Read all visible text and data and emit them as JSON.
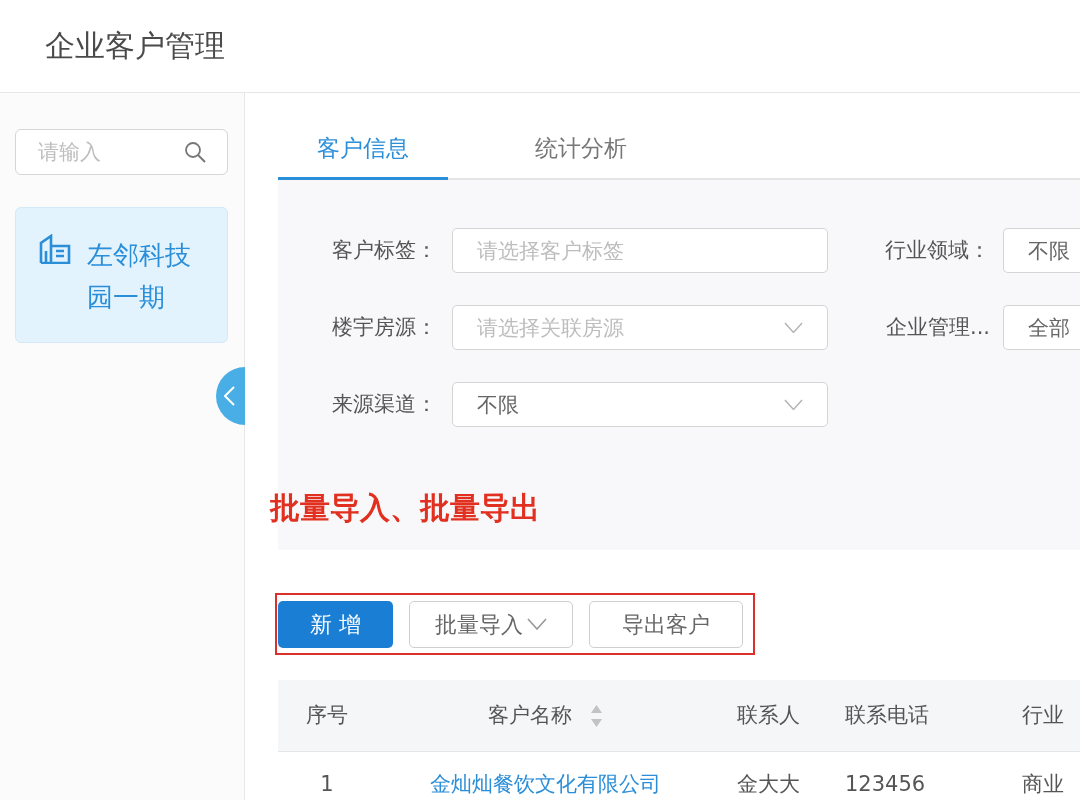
{
  "header": {
    "title": "企业客户管理"
  },
  "sidebar": {
    "search": {
      "placeholder": "请输入"
    },
    "items": [
      {
        "label": "左邻科技园一期",
        "selected": true
      }
    ]
  },
  "tabs": [
    {
      "label": "客户信息",
      "selected": true
    },
    {
      "label": "统计分析",
      "selected": false
    }
  ],
  "filters": [
    {
      "label": "客户标签：",
      "kind": "input",
      "placeholder": "请选择客户标签"
    },
    {
      "label": "行业领域：",
      "kind": "input",
      "value": "不限"
    },
    {
      "label": "楼宇房源：",
      "kind": "select",
      "placeholder": "请选择关联房源"
    },
    {
      "label": "企业管理...",
      "kind": "input",
      "value": "全部"
    },
    {
      "label": "来源渠道：",
      "kind": "select",
      "value": "不限"
    }
  ],
  "annotation": {
    "text": "批量导入、批量导出"
  },
  "toolbar": [
    {
      "label": "新 增",
      "kind": "primary"
    },
    {
      "label": "批量导入",
      "kind": "dropdown"
    },
    {
      "label": "导出客户",
      "kind": "default"
    }
  ],
  "table": {
    "columns": [
      {
        "label": "序号",
        "kind": "index",
        "sortable": false
      },
      {
        "label": "客户名称",
        "kind": "link",
        "sortable": true
      },
      {
        "label": "联系人",
        "kind": "text",
        "sortable": false
      },
      {
        "label": "联系电话",
        "kind": "text",
        "sortable": false
      },
      {
        "label": "行业",
        "kind": "text",
        "sortable": false
      }
    ],
    "rows": [
      {
        "cells": [
          "1",
          "金灿灿餐饮文化有限公司",
          "金大大",
          "123456",
          "商业"
        ]
      }
    ]
  }
}
